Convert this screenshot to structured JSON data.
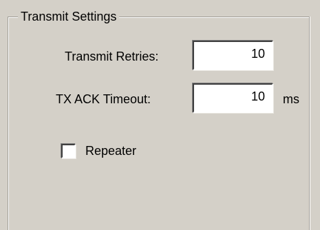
{
  "group": {
    "title": "Transmit Settings"
  },
  "fields": {
    "transmit_retries": {
      "label": "Transmit Retries:",
      "value": "10"
    },
    "tx_ack_timeout": {
      "label": "TX ACK Timeout:",
      "value": "10",
      "unit": "ms"
    }
  },
  "repeater": {
    "label": "Repeater",
    "checked": false
  },
  "colors": {
    "background": "#d4d0c8",
    "field_background": "#ffffff"
  }
}
